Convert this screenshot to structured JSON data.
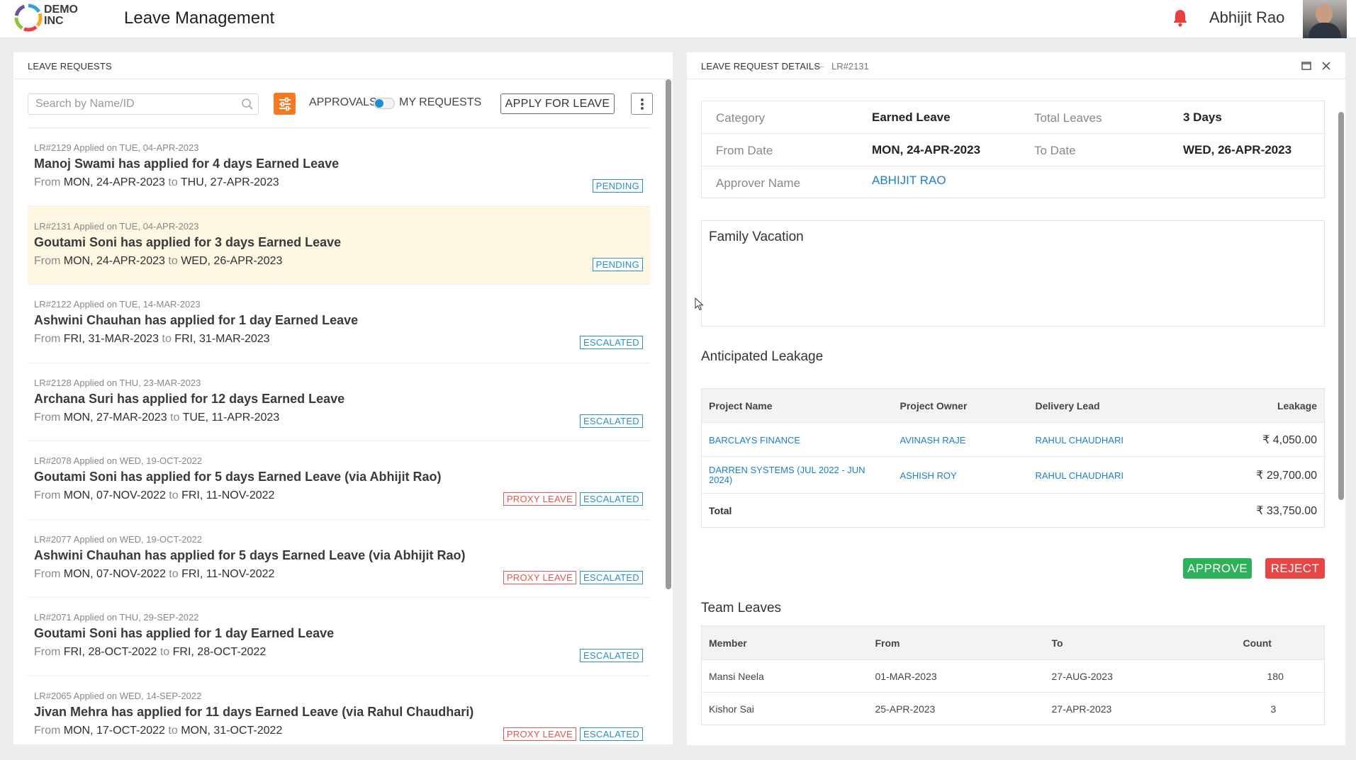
{
  "header": {
    "logo_line1": "DEMO",
    "logo_line2": "INC",
    "app_title": "Leave Management",
    "user_name": "Abhijit Rao",
    "bell_color": "#e8403f"
  },
  "left_panel": {
    "title": "LEAVE REQUESTS",
    "search_placeholder": "Search by Name/ID",
    "toggle_left": "APPROVALS",
    "toggle_right": "MY REQUESTS",
    "apply_label": "APPLY FOR LEAVE",
    "requests": [
      {
        "meta": "LR#2129 Applied on TUE, 04-APR-2023",
        "title": "Manoj Swami has applied for 4 days Earned Leave",
        "from_word": "From",
        "from": "MON, 24-APR-2023",
        "to_word": "to",
        "to": "THU, 27-APR-2023",
        "badges": [
          "PENDING"
        ],
        "selected": false
      },
      {
        "meta": "LR#2131 Applied on TUE, 04-APR-2023",
        "title": "Goutami Soni has applied for 3 days Earned Leave",
        "from_word": "From",
        "from": "MON, 24-APR-2023",
        "to_word": "to",
        "to": "WED, 26-APR-2023",
        "badges": [
          "PENDING"
        ],
        "selected": true
      },
      {
        "meta": "LR#2122 Applied on TUE, 14-MAR-2023",
        "title": "Ashwini Chauhan has applied for 1 day Earned Leave",
        "from_word": "From",
        "from": "FRI, 31-MAR-2023",
        "to_word": "to",
        "to": "FRI, 31-MAR-2023",
        "badges": [
          "ESCALATED"
        ],
        "selected": false
      },
      {
        "meta": "LR#2128 Applied on THU, 23-MAR-2023",
        "title": "Archana Suri has applied for 12 days Earned Leave",
        "from_word": "From",
        "from": "MON, 27-MAR-2023",
        "to_word": "to",
        "to": "TUE, 11-APR-2023",
        "badges": [
          "ESCALATED"
        ],
        "selected": false
      },
      {
        "meta": "LR#2078 Applied on WED, 19-OCT-2022",
        "title": "Goutami Soni has applied for 5 days Earned Leave (via Abhijit Rao)",
        "from_word": "From",
        "from": "MON, 07-NOV-2022",
        "to_word": "to",
        "to": "FRI, 11-NOV-2022",
        "badges": [
          "PROXY LEAVE",
          "ESCALATED"
        ],
        "selected": false
      },
      {
        "meta": "LR#2077 Applied on WED, 19-OCT-2022",
        "title": "Ashwini Chauhan has applied for 5 days Earned Leave (via Abhijit Rao)",
        "from_word": "From",
        "from": "MON, 07-NOV-2022",
        "to_word": "to",
        "to": "FRI, 11-NOV-2022",
        "badges": [
          "PROXY LEAVE",
          "ESCALATED"
        ],
        "selected": false
      },
      {
        "meta": "LR#2071 Applied on THU, 29-SEP-2022",
        "title": "Goutami Soni has applied for 1 day Earned Leave",
        "from_word": "From",
        "from": "FRI, 28-OCT-2022",
        "to_word": "to",
        "to": "FRI, 28-OCT-2022",
        "badges": [
          "ESCALATED"
        ],
        "selected": false
      },
      {
        "meta": "LR#2065 Applied on WED, 14-SEP-2022",
        "title": "Jivan Mehra has applied for 11 days Earned Leave (via Rahul Chaudhari)",
        "from_word": "From",
        "from": "MON, 17-OCT-2022",
        "to_word": "to",
        "to": "MON, 31-OCT-2022",
        "badges": [
          "PROXY LEAVE",
          "ESCALATED"
        ],
        "selected": false
      }
    ]
  },
  "right_panel": {
    "title": "LEAVE REQUEST DETAILS",
    "separator": "—",
    "request_id": "LR#2131",
    "details": {
      "category_label": "Category",
      "category_value": "Earned Leave",
      "total_label": "Total Leaves",
      "total_value": "3 Days",
      "from_label": "From Date",
      "from_value": "MON, 24-APR-2023",
      "to_label": "To Date",
      "to_value": "WED, 26-APR-2023",
      "approver_label": "Approver Name",
      "approver_value": "ABHIJIT RAO"
    },
    "reason": "Family Vacation",
    "leakage_title": "Anticipated Leakage",
    "leakage_headers": [
      "Project Name",
      "Project Owner",
      "Delivery Lead",
      "Leakage"
    ],
    "leakage_rows": [
      [
        "BARCLAYS FINANCE",
        "AVINASH RAJE",
        "RAHUL CHAUDHARI",
        "₹ 4,050.00"
      ],
      [
        "DARREN SYSTEMS (JUL 2022 - JUN 2024)",
        "ASHISH ROY",
        "RAHUL CHAUDHARI",
        "₹ 29,700.00"
      ]
    ],
    "leakage_total_label": "Total",
    "leakage_total_value": "₹ 33,750.00",
    "approve_label": "APPROVE",
    "reject_label": "REJECT",
    "team_title": "Team Leaves",
    "team_headers": [
      "Member",
      "From",
      "To",
      "Count"
    ],
    "team_rows": [
      [
        "Mansi Neela",
        "01-MAR-2023",
        "27-AUG-2023",
        "180"
      ],
      [
        "Kishor Sai",
        "25-APR-2023",
        "27-APR-2023",
        "3"
      ]
    ]
  },
  "icons": {
    "search": "search-icon",
    "filter": "filter-sliders-icon",
    "more": "more-vertical-icon",
    "maximize": "maximize-icon",
    "close": "close-icon",
    "bell": "bell-icon"
  },
  "colors": {
    "accent_orange": "#f47920",
    "link_blue": "#1e7fc4",
    "badge_blue": "#2a8fc9",
    "badge_red": "#e05555",
    "approve_green": "#2fb05a",
    "reject_red": "#e84545",
    "selected_row": "#fdf7e2"
  }
}
